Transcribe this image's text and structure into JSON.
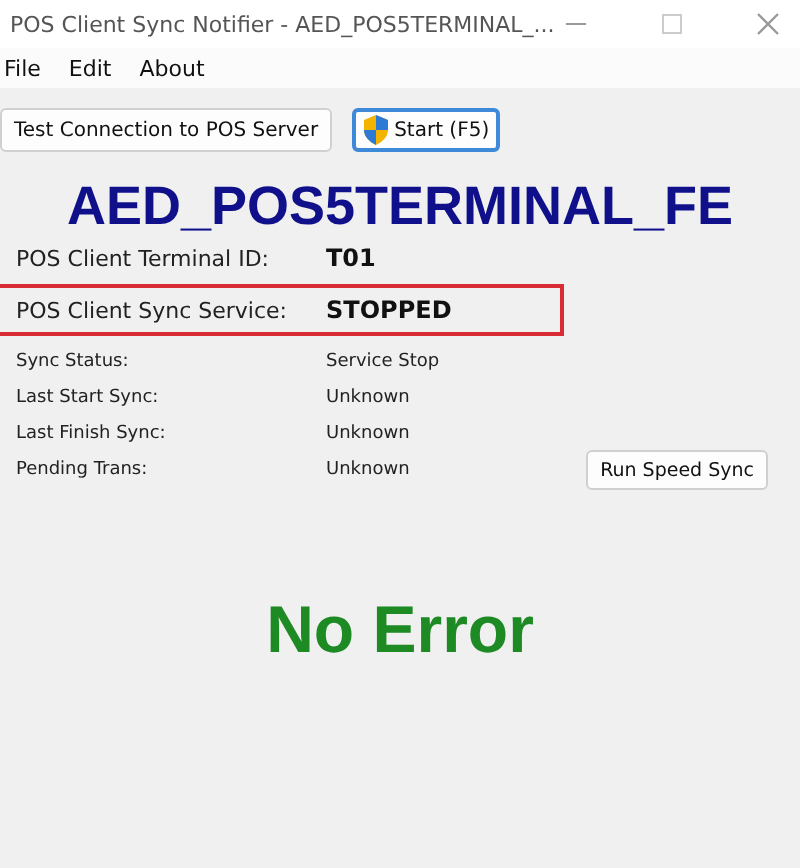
{
  "window": {
    "title": "POS Client Sync Notifier - AED_POS5TERMINAL_..."
  },
  "menu": [
    "File",
    "Edit",
    "About"
  ],
  "toolbar": [
    {
      "label": "Test Connection to POS Server",
      "kind": "plain",
      "focused": false
    },
    {
      "label": "Start (F5)",
      "kind": "shield",
      "focused": true
    }
  ],
  "terminal_name": "AED_POS5TERMINAL_FE",
  "main_fields": [
    {
      "label": "POS Client Terminal ID:",
      "value": "T01",
      "highlighted": false
    },
    {
      "label": "POS Client Sync Service:",
      "value": "STOPPED",
      "highlighted": true
    }
  ],
  "details": [
    {
      "label": "Sync Status:",
      "value": "Service Stop"
    },
    {
      "label": "Last Start Sync:",
      "value": "Unknown"
    },
    {
      "label": "Last Finish Sync:",
      "value": "Unknown"
    },
    {
      "label": "Pending Trans:",
      "value": "Unknown",
      "action": "Run Speed Sync"
    }
  ],
  "message": "No Error"
}
